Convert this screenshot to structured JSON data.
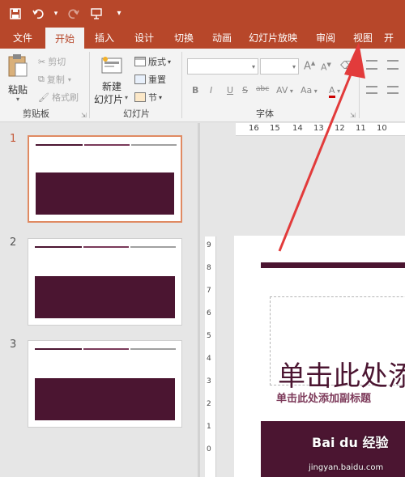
{
  "qat": {
    "icons": [
      "save-icon",
      "undo-icon",
      "redo-icon",
      "present-icon",
      "customize-icon"
    ],
    "more": "▾"
  },
  "tabs": [
    "文件",
    "开始",
    "插入",
    "设计",
    "切换",
    "动画",
    "幻灯片放映",
    "审阅",
    "视图",
    "开"
  ],
  "active_tab_index": 1,
  "ribbon": {
    "clipboard": {
      "paste": "粘贴",
      "cut": "剪切",
      "copy": "复制",
      "format_painter": "格式刷",
      "label": "剪贴板"
    },
    "slides": {
      "new_slide": "新建",
      "new_slide_2": "幻灯片",
      "layout": "版式",
      "reset": "重置",
      "section": "节",
      "label": "幻灯片"
    },
    "font": {
      "label": "字体",
      "grow": "A",
      "shrink": "A",
      "bold": "B",
      "italic": "I",
      "underline": "U",
      "strike": "S",
      "shadow": "abc",
      "spacing": "AV",
      "case": "Aa",
      "color": "A"
    }
  },
  "thumbnails": [
    {
      "num": "1",
      "active": true
    },
    {
      "num": "2",
      "active": false
    },
    {
      "num": "3",
      "active": false
    }
  ],
  "ruler": {
    "h": [
      "16",
      "15",
      "14",
      "13",
      "12",
      "11",
      "10"
    ],
    "v": [
      "9",
      "8",
      "7",
      "6",
      "5",
      "4",
      "3",
      "2",
      "1",
      "0"
    ]
  },
  "slide": {
    "title": "单击此处添加标题",
    "subtitle": "单击此处添加副标题"
  },
  "colors": {
    "accent": "#b7472a",
    "slide_dark": "#4b1531",
    "annotation": "#e23b3b"
  },
  "watermark": {
    "brand": "Bai du 经验",
    "url": "jingyan.baidu.com"
  }
}
